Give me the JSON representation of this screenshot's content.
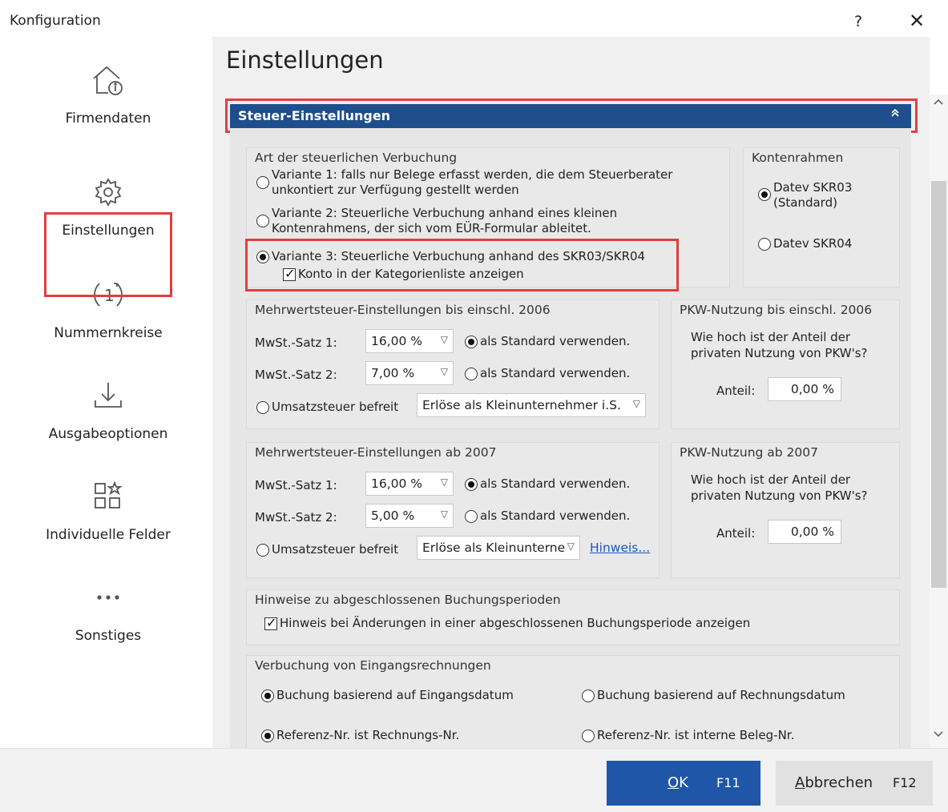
{
  "window": {
    "title": "Konfiguration",
    "help": "?",
    "close": "✕"
  },
  "sidebar": {
    "items": [
      {
        "label": "Firmendaten"
      },
      {
        "label": "Einstellungen"
      },
      {
        "label": "Nummernkreise"
      },
      {
        "label": "Ausgabeoptionen"
      },
      {
        "label": "Individuelle Felder"
      },
      {
        "label": "Sonstiges"
      }
    ]
  },
  "main": {
    "title": "Einstellungen",
    "section": {
      "title": "Steuer-Einstellungen",
      "collapse": "«"
    },
    "art": {
      "title": "Art der steuerlichen Verbuchung",
      "v1": "Variante 1: falls nur Belege erfasst werden, die dem Steuerberater unkontiert zur Verfügung gestellt werden",
      "v2": "Variante 2: Steuerliche Verbuchung anhand eines kleinen Kontenrahmens, der sich vom EÜR-Formular ableitet.",
      "v3": "Variante 3: Steuerliche Verbuchung anhand des SKR03/SKR04",
      "konto": "Konto in der Kategorienliste anzeigen"
    },
    "kontenrahmen": {
      "title": "Kontenrahmen",
      "skr03": "Datev SKR03 (Standard)",
      "skr04": "Datev SKR04"
    },
    "mwst2006": {
      "title": "Mehrwertsteuer-Einstellungen bis einschl. 2006",
      "satz1_label": "MwSt.-Satz 1:",
      "satz1_value": "16,00 %",
      "satz2_label": "MwSt.-Satz 2:",
      "satz2_value": "7,00 %",
      "standard": "als Standard verwenden.",
      "befreit": "Umsatzsteuer befreit",
      "befreit_value": "Erlöse als Kleinunternehmer i.S."
    },
    "pkw2006": {
      "title": "PKW-Nutzung bis einschl. 2006",
      "question": "Wie hoch ist der Anteil der privaten Nutzung von PKW's?",
      "anteil_label": "Anteil:",
      "anteil_value": "0,00 %"
    },
    "mwst2007": {
      "title": "Mehrwertsteuer-Einstellungen ab 2007",
      "satz1_label": "MwSt.-Satz 1:",
      "satz1_value": "16,00 %",
      "satz2_label": "MwSt.-Satz 2:",
      "satz2_value": "5,00 %",
      "standard": "als Standard verwenden.",
      "befreit": "Umsatzsteuer befreit",
      "befreit_value": "Erlöse als Kleinunterne",
      "hinweis": "Hinweis..."
    },
    "pkw2007": {
      "title": "PKW-Nutzung ab 2007",
      "question": "Wie hoch ist der Anteil der privaten Nutzung von PKW's?",
      "anteil_label": "Anteil:",
      "anteil_value": "0,00 %"
    },
    "perioden": {
      "title": "Hinweise zu abgeschlossenen Buchungsperioden",
      "check": "Hinweis bei Änderungen in einer abgeschlossenen Buchungsperiode anzeigen"
    },
    "eingang": {
      "title": "Verbuchung von Eingangsrechnungen",
      "opt1": "Buchung basierend auf Eingangsdatum",
      "opt2": "Buchung basierend auf Rechnungsdatum",
      "opt3": "Referenz-Nr. ist Rechnungs-Nr.",
      "opt4": "Referenz-Nr. ist interne Beleg-Nr."
    }
  },
  "footer": {
    "ok_key": "O",
    "ok_rest": "K",
    "ok_shortcut": "F11",
    "cancel_key": "A",
    "cancel_rest": "bbrechen",
    "cancel_shortcut": "F12"
  },
  "colors": {
    "accent": "#1f4e8c",
    "button": "#1f56a8",
    "highlight": "#e03f3f",
    "link": "#1a56c8"
  }
}
